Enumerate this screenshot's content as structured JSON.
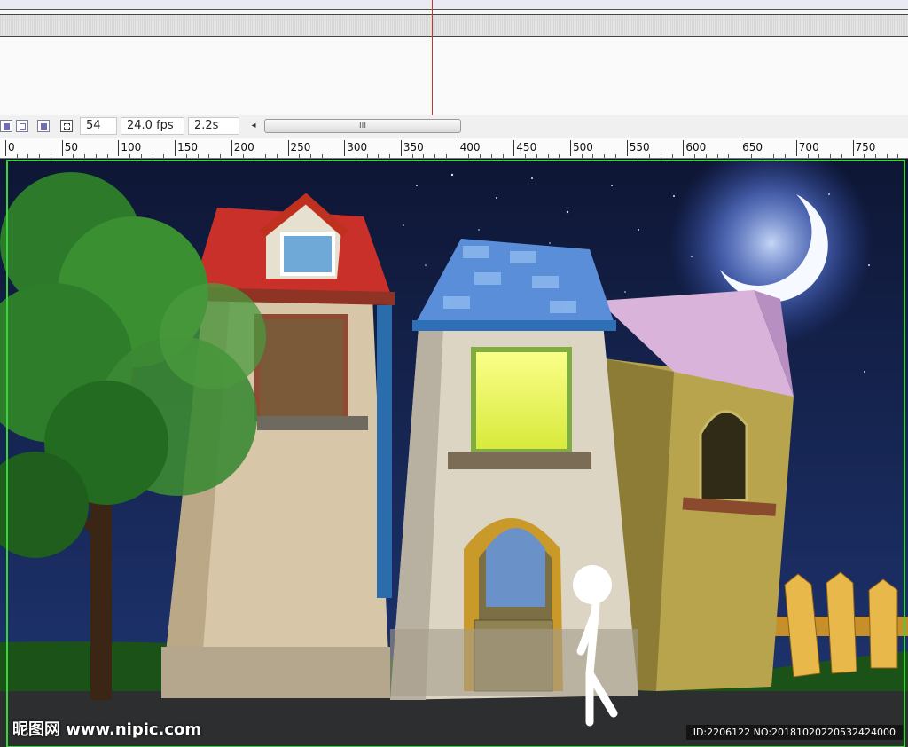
{
  "status": {
    "frame": "54",
    "fps": "24.0 fps",
    "time": "2.2s",
    "scroll_left_glyph": "◂",
    "scroll_grip": "III"
  },
  "ruler": {
    "labels": [
      "0",
      "50",
      "100",
      "150",
      "200",
      "250",
      "300",
      "350",
      "400",
      "450",
      "500",
      "550",
      "600",
      "650",
      "700",
      "750"
    ]
  },
  "watermark": {
    "logo": "昵图网 www.nipic.com",
    "id_text": "ID:2206122 NO:20181020220532424000"
  },
  "colors": {
    "sky_top": "#0f1838",
    "sky_bottom": "#1f3470",
    "moon": "#f4f8ff",
    "moon_glow": "#8fb3ff",
    "stage_border": "#3ad53a"
  },
  "icons": [
    "frame-onion-icon",
    "onion-outline-icon",
    "edit-multiple-icon",
    "center-frame-icon"
  ]
}
